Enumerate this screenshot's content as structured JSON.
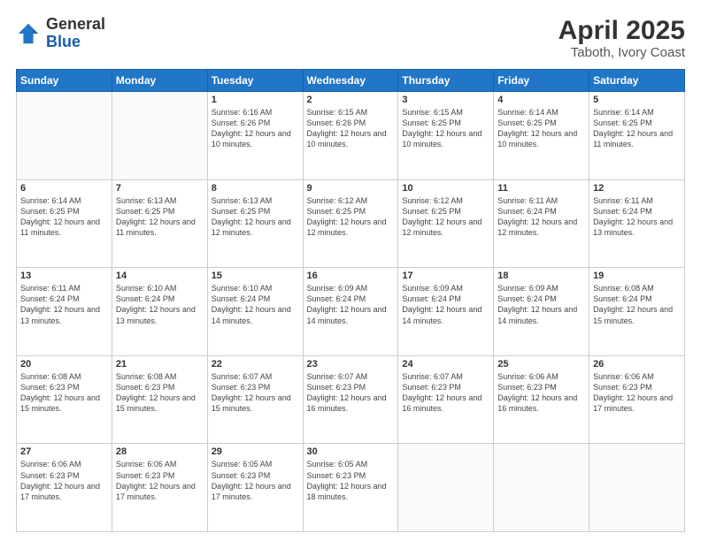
{
  "logo": {
    "general": "General",
    "blue": "Blue"
  },
  "title": "April 2025",
  "location": "Taboth, Ivory Coast",
  "days_of_week": [
    "Sunday",
    "Monday",
    "Tuesday",
    "Wednesday",
    "Thursday",
    "Friday",
    "Saturday"
  ],
  "weeks": [
    [
      {
        "day": "",
        "info": ""
      },
      {
        "day": "",
        "info": ""
      },
      {
        "day": "1",
        "info": "Sunrise: 6:16 AM\nSunset: 6:26 PM\nDaylight: 12 hours and 10 minutes."
      },
      {
        "day": "2",
        "info": "Sunrise: 6:15 AM\nSunset: 6:26 PM\nDaylight: 12 hours and 10 minutes."
      },
      {
        "day": "3",
        "info": "Sunrise: 6:15 AM\nSunset: 6:25 PM\nDaylight: 12 hours and 10 minutes."
      },
      {
        "day": "4",
        "info": "Sunrise: 6:14 AM\nSunset: 6:25 PM\nDaylight: 12 hours and 10 minutes."
      },
      {
        "day": "5",
        "info": "Sunrise: 6:14 AM\nSunset: 6:25 PM\nDaylight: 12 hours and 11 minutes."
      }
    ],
    [
      {
        "day": "6",
        "info": "Sunrise: 6:14 AM\nSunset: 6:25 PM\nDaylight: 12 hours and 11 minutes."
      },
      {
        "day": "7",
        "info": "Sunrise: 6:13 AM\nSunset: 6:25 PM\nDaylight: 12 hours and 11 minutes."
      },
      {
        "day": "8",
        "info": "Sunrise: 6:13 AM\nSunset: 6:25 PM\nDaylight: 12 hours and 12 minutes."
      },
      {
        "day": "9",
        "info": "Sunrise: 6:12 AM\nSunset: 6:25 PM\nDaylight: 12 hours and 12 minutes."
      },
      {
        "day": "10",
        "info": "Sunrise: 6:12 AM\nSunset: 6:25 PM\nDaylight: 12 hours and 12 minutes."
      },
      {
        "day": "11",
        "info": "Sunrise: 6:11 AM\nSunset: 6:24 PM\nDaylight: 12 hours and 12 minutes."
      },
      {
        "day": "12",
        "info": "Sunrise: 6:11 AM\nSunset: 6:24 PM\nDaylight: 12 hours and 13 minutes."
      }
    ],
    [
      {
        "day": "13",
        "info": "Sunrise: 6:11 AM\nSunset: 6:24 PM\nDaylight: 12 hours and 13 minutes."
      },
      {
        "day": "14",
        "info": "Sunrise: 6:10 AM\nSunset: 6:24 PM\nDaylight: 12 hours and 13 minutes."
      },
      {
        "day": "15",
        "info": "Sunrise: 6:10 AM\nSunset: 6:24 PM\nDaylight: 12 hours and 14 minutes."
      },
      {
        "day": "16",
        "info": "Sunrise: 6:09 AM\nSunset: 6:24 PM\nDaylight: 12 hours and 14 minutes."
      },
      {
        "day": "17",
        "info": "Sunrise: 6:09 AM\nSunset: 6:24 PM\nDaylight: 12 hours and 14 minutes."
      },
      {
        "day": "18",
        "info": "Sunrise: 6:09 AM\nSunset: 6:24 PM\nDaylight: 12 hours and 14 minutes."
      },
      {
        "day": "19",
        "info": "Sunrise: 6:08 AM\nSunset: 6:24 PM\nDaylight: 12 hours and 15 minutes."
      }
    ],
    [
      {
        "day": "20",
        "info": "Sunrise: 6:08 AM\nSunset: 6:23 PM\nDaylight: 12 hours and 15 minutes."
      },
      {
        "day": "21",
        "info": "Sunrise: 6:08 AM\nSunset: 6:23 PM\nDaylight: 12 hours and 15 minutes."
      },
      {
        "day": "22",
        "info": "Sunrise: 6:07 AM\nSunset: 6:23 PM\nDaylight: 12 hours and 15 minutes."
      },
      {
        "day": "23",
        "info": "Sunrise: 6:07 AM\nSunset: 6:23 PM\nDaylight: 12 hours and 16 minutes."
      },
      {
        "day": "24",
        "info": "Sunrise: 6:07 AM\nSunset: 6:23 PM\nDaylight: 12 hours and 16 minutes."
      },
      {
        "day": "25",
        "info": "Sunrise: 6:06 AM\nSunset: 6:23 PM\nDaylight: 12 hours and 16 minutes."
      },
      {
        "day": "26",
        "info": "Sunrise: 6:06 AM\nSunset: 6:23 PM\nDaylight: 12 hours and 17 minutes."
      }
    ],
    [
      {
        "day": "27",
        "info": "Sunrise: 6:06 AM\nSunset: 6:23 PM\nDaylight: 12 hours and 17 minutes."
      },
      {
        "day": "28",
        "info": "Sunrise: 6:06 AM\nSunset: 6:23 PM\nDaylight: 12 hours and 17 minutes."
      },
      {
        "day": "29",
        "info": "Sunrise: 6:05 AM\nSunset: 6:23 PM\nDaylight: 12 hours and 17 minutes."
      },
      {
        "day": "30",
        "info": "Sunrise: 6:05 AM\nSunset: 6:23 PM\nDaylight: 12 hours and 18 minutes."
      },
      {
        "day": "",
        "info": ""
      },
      {
        "day": "",
        "info": ""
      },
      {
        "day": "",
        "info": ""
      }
    ]
  ]
}
